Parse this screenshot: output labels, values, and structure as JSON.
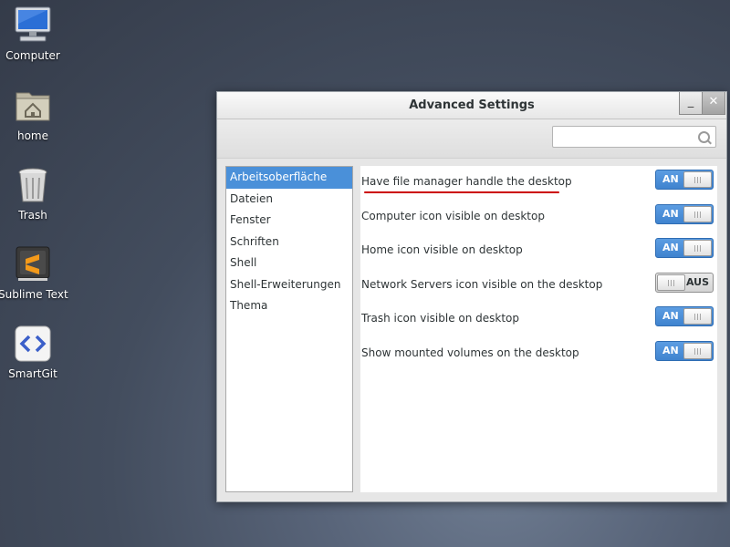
{
  "desktop": {
    "icons": [
      {
        "label": "Computer",
        "icon": "computer-icon"
      },
      {
        "label": "home",
        "icon": "home-folder-icon"
      },
      {
        "label": "Trash",
        "icon": "trash-icon"
      },
      {
        "label": "Sublime Text",
        "icon": "sublime-text-icon"
      },
      {
        "label": "SmartGit",
        "icon": "smartgit-icon"
      }
    ]
  },
  "window": {
    "title": "Advanced Settings",
    "minimize_label": "_",
    "close_label": "✕",
    "search": {
      "placeholder": "",
      "value": ""
    }
  },
  "sidebar": {
    "items": [
      {
        "label": "Arbeitsoberfläche",
        "selected": true
      },
      {
        "label": "Dateien"
      },
      {
        "label": "Fenster"
      },
      {
        "label": "Schriften"
      },
      {
        "label": "Shell"
      },
      {
        "label": "Shell-Erweiterungen"
      },
      {
        "label": "Thema"
      }
    ]
  },
  "settings": {
    "rows": [
      {
        "label": "Have file manager handle the desktop",
        "state": "AN",
        "on": true
      },
      {
        "label": "Computer icon visible on desktop",
        "state": "AN",
        "on": true
      },
      {
        "label": "Home icon visible on desktop",
        "state": "AN",
        "on": true
      },
      {
        "label": "Network Servers icon visible on the desktop",
        "state": "AUS",
        "on": false
      },
      {
        "label": "Trash icon visible on desktop",
        "state": "AN",
        "on": true
      },
      {
        "label": "Show mounted volumes on the desktop",
        "state": "AN",
        "on": true
      }
    ]
  },
  "colors": {
    "accent": "#4a90d9",
    "annotation_underline": "#cc0000"
  }
}
